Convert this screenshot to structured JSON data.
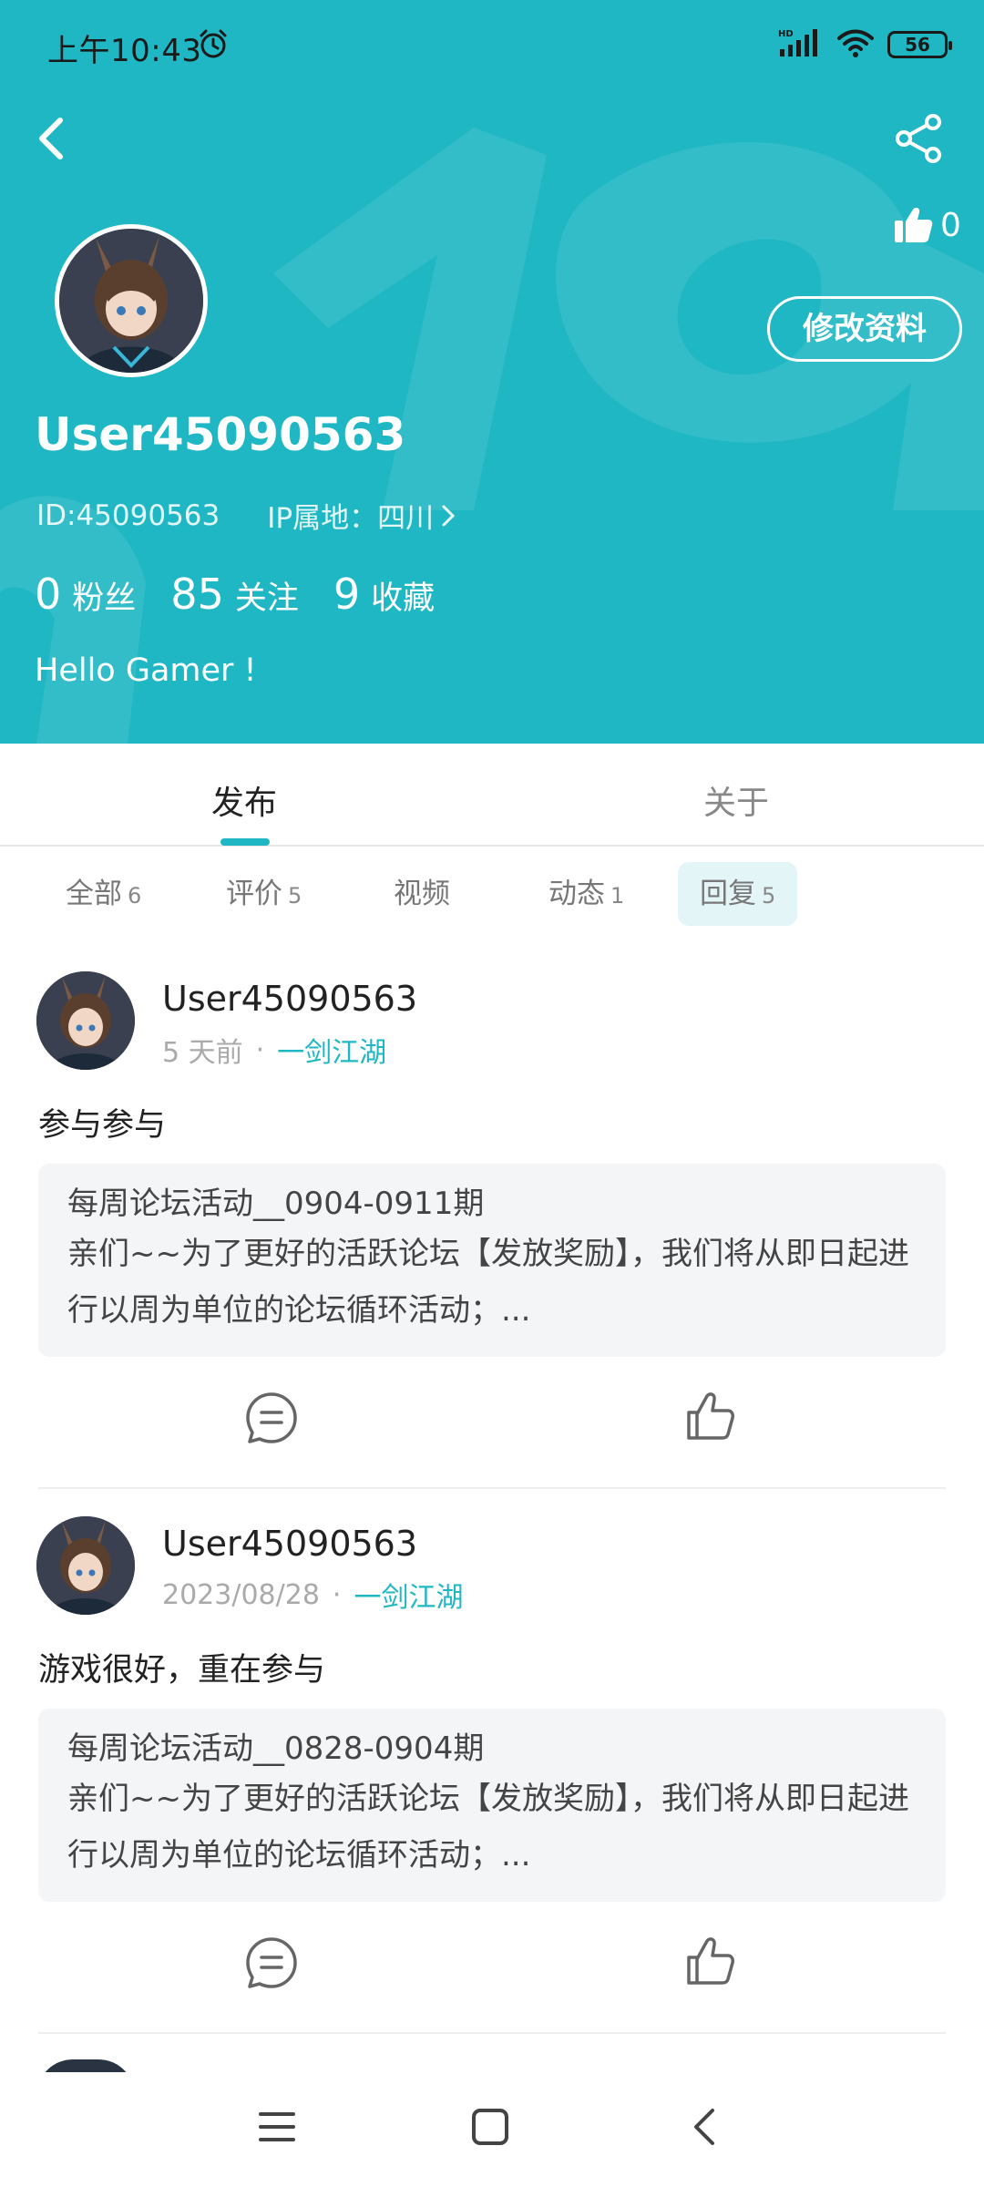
{
  "status_bar": {
    "time": "上午10:43",
    "battery": "56",
    "network_label": "HD"
  },
  "profile": {
    "like_count": "0",
    "edit_label": "修改资料",
    "username": "User45090563",
    "id_text": "ID:45090563",
    "ip_text": "IP属地：四川",
    "stats": [
      {
        "num": "0",
        "label": "粉丝"
      },
      {
        "num": "85",
        "label": "关注"
      },
      {
        "num": "9",
        "label": "收藏"
      }
    ],
    "bio": "Hello Gamer !"
  },
  "tabs": {
    "publish": "发布",
    "about": "关于"
  },
  "filters": [
    {
      "label": "全部",
      "count": "6"
    },
    {
      "label": "评价",
      "count": "5"
    },
    {
      "label": "视频",
      "count": ""
    },
    {
      "label": "动态",
      "count": "1"
    },
    {
      "label": "回复",
      "count": "5"
    }
  ],
  "posts": [
    {
      "user": "User45090563",
      "time": "5 天前",
      "game": "一剑江湖",
      "text": "参与参与",
      "card_title": "每周论坛活动__0904-0911期",
      "card_body": "亲们~~为了更好的活跃论坛【发放奖励】，我们将从即日起进行以周为单位的论坛循环活动；..."
    },
    {
      "user": "User45090563",
      "time": "2023/08/28",
      "game": "一剑江湖",
      "text": "游戏很好，重在参与",
      "card_title": "每周论坛活动__0828-0904期",
      "card_body": "亲们~~为了更好的活跃论坛【发放奖励】，我们将从即日起进行以周为单位的论坛循环活动；..."
    }
  ],
  "colors": {
    "accent": "#1fb7c4",
    "header_bg": "#1fb7c4",
    "card_bg": "#f4f5f7"
  }
}
